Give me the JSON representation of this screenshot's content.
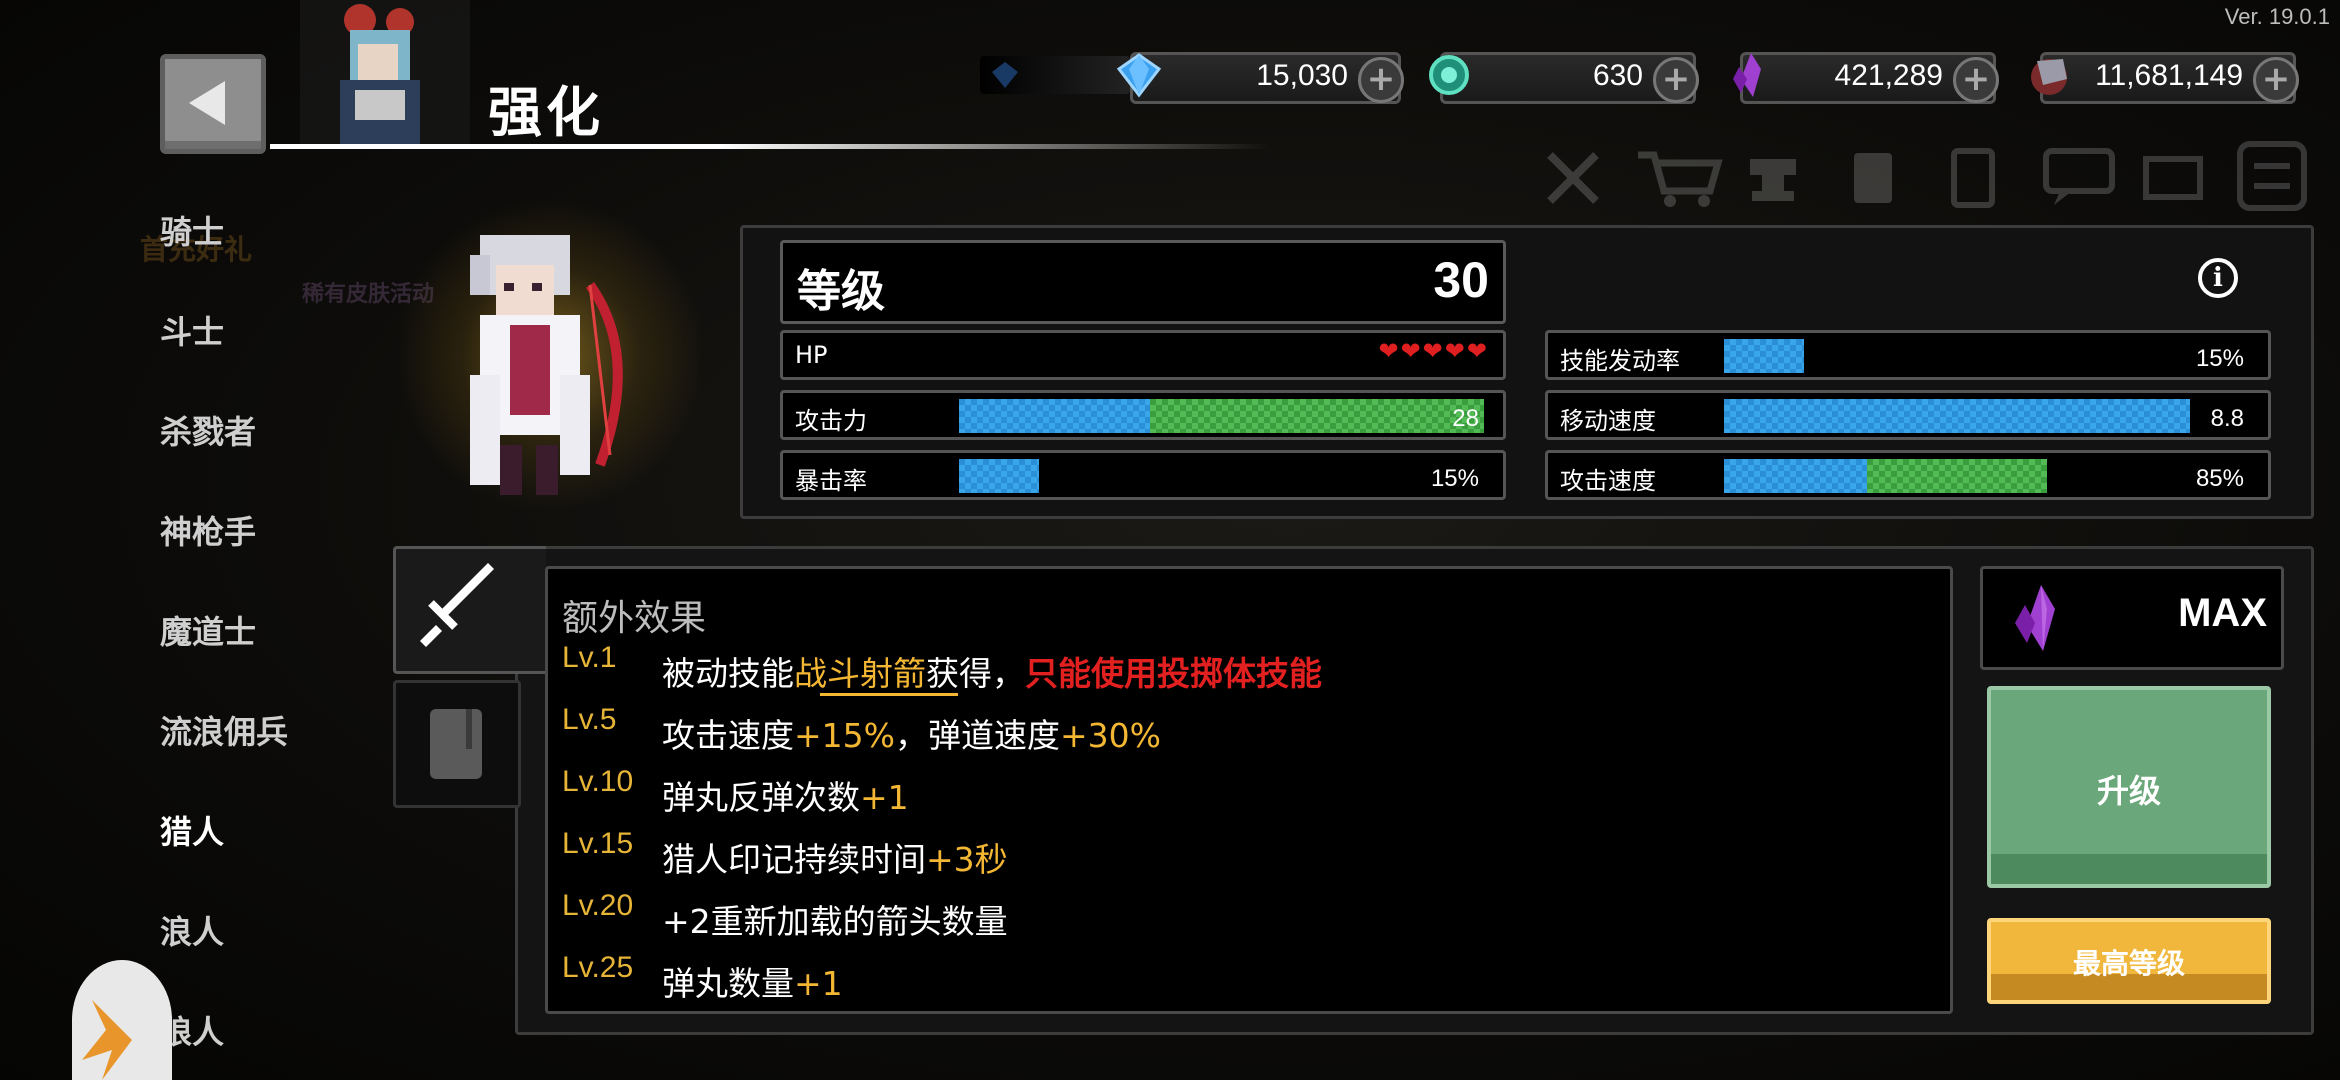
{
  "version": "Ver. 19.0.1",
  "header": {
    "title": "强化"
  },
  "currencies": [
    {
      "name": "gem",
      "value": "15,030",
      "color": "#3aa0f0"
    },
    {
      "name": "emerald",
      "value": "630",
      "color": "#2fbfa0"
    },
    {
      "name": "purple-crystal",
      "value": "421,289",
      "color": "#a040d0"
    },
    {
      "name": "ore",
      "value": "11,681,149",
      "color": "#c04040"
    }
  ],
  "classes": [
    {
      "label": "骑士"
    },
    {
      "label": "斗士"
    },
    {
      "label": "杀戮者"
    },
    {
      "label": "神枪手"
    },
    {
      "label": "魔道士"
    },
    {
      "label": "流浪佣兵"
    },
    {
      "label": "猎人",
      "active": true
    },
    {
      "label": "浪人"
    },
    {
      "label": "狼人"
    }
  ],
  "faded_badges": [
    "首充好礼",
    "稀有皮肤活动"
  ],
  "stats": {
    "level_label": "等级",
    "level_value": "30",
    "hp_label": "HP",
    "hp_hearts": "❤❤❤❤❤",
    "attack_label": "攻击力",
    "attack_value": "28",
    "attack_base": 0.36,
    "attack_bonus": 0.63,
    "crit_label": "暴击率",
    "crit_value": "15%",
    "crit_fill": 0.15,
    "skill_rate_label": "技能发动率",
    "skill_rate_value": "15%",
    "skill_rate_fill": 0.15,
    "move_speed_label": "移动速度",
    "move_speed_value": "8.8",
    "move_speed_fill": 0.88,
    "attack_speed_label": "攻击速度",
    "attack_speed_value": "85%",
    "attack_speed_base": 0.27,
    "attack_speed_bonus": 0.34
  },
  "effects": {
    "title": "额外效果",
    "rows": [
      {
        "lv": "Lv.1",
        "parts": [
          {
            "t": "被动技能",
            "c": ""
          },
          {
            "t": "战斗射箭",
            "c": "hl-y"
          },
          {
            "t": "获得，",
            "c": ""
          },
          {
            "t": "只能使用投掷体技能",
            "c": "hl-r"
          }
        ]
      },
      {
        "lv": "Lv.5",
        "parts": [
          {
            "t": "攻击速度",
            "c": ""
          },
          {
            "t": "+15%",
            "c": "hl-y"
          },
          {
            "t": "，弹道速度",
            "c": ""
          },
          {
            "t": "+30%",
            "c": "hl-y"
          }
        ]
      },
      {
        "lv": "Lv.10",
        "parts": [
          {
            "t": "弹丸反弹次数",
            "c": ""
          },
          {
            "t": "+1",
            "c": "hl-y"
          }
        ]
      },
      {
        "lv": "Lv.15",
        "parts": [
          {
            "t": "猎人印记持续时间",
            "c": ""
          },
          {
            "t": "+3秒",
            "c": "hl-y"
          }
        ]
      },
      {
        "lv": "Lv.20",
        "parts": [
          {
            "t": "+2重新加载的箭头数量",
            "c": ""
          }
        ]
      },
      {
        "lv": "Lv.25",
        "parts": [
          {
            "t": "弹丸数量",
            "c": ""
          },
          {
            "t": "+1",
            "c": "hl-y"
          }
        ]
      }
    ]
  },
  "upgrade": {
    "max_label": "MAX",
    "upgrade_label": "升级",
    "max_level_label": "最高等级"
  }
}
